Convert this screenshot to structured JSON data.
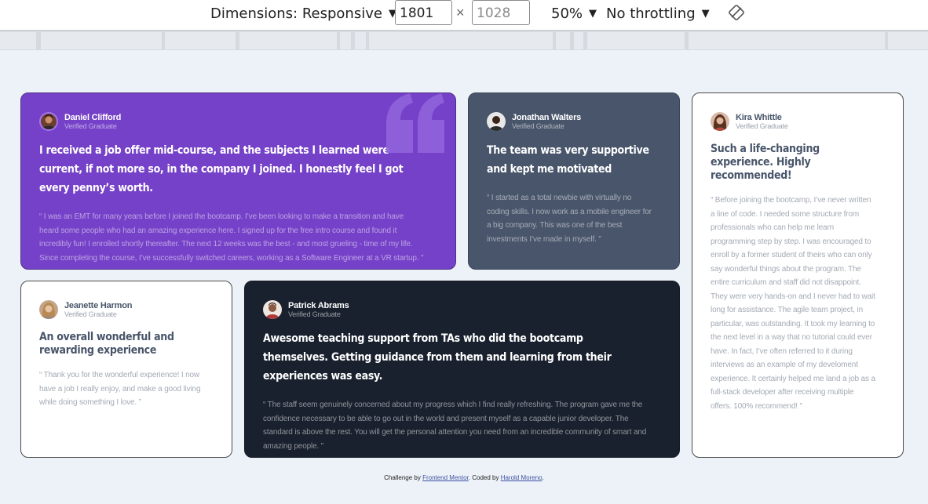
{
  "devtools": {
    "dimensions_label": "Dimensions: Responsive",
    "width_value": "1801",
    "height_placeholder": "1028",
    "times": "×",
    "zoom": "50%",
    "throttling": "No throttling",
    "caret": "▼"
  },
  "testimonials": [
    {
      "name": "Daniel Clifford",
      "status": "Verified Graduate",
      "headline": "I received a job offer mid-course, and the subjects I learned were current, if not more so, in the company I joined. I honestly feel I got every penny’s worth.",
      "quote": "“ I was an EMT for many years before I joined the bootcamp. I’ve been looking to make a transition and have heard some people who had an amazing experience here. I signed up for the free intro course and found it incredibly fun! I enrolled shortly thereafter. The next 12 weeks was the best - and most grueling - time of my life. Since completing the course, I’ve successfully switched careers, working as a Software Engineer at a VR startup. ”"
    },
    {
      "name": "Jonathan Walters",
      "status": "Verified Graduate",
      "headline": "The team was very supportive and kept me motivated",
      "quote": "“ I started as a total newbie with virtually no coding skills. I now work as a mobile engineer for a big company. This was one of the best investments I’ve made in myself. ”"
    },
    {
      "name": "Kira Whittle",
      "status": "Verified Graduate",
      "headline": "Such a life-changing experience. Highly recommended!",
      "quote": "“ Before joining the bootcamp, I’ve never written a line of code. I needed some structure from professionals who can help me learn programming step by step. I was encouraged to enroll by a former student of theirs who can only say wonderful things about the program. The entire curriculum and staff did not disappoint. They were very hands-on and I never had to wait long for assistance. The agile team project, in particular, was outstanding. It took my learning to the next level in a way that no tutorial could ever have. In fact, I’ve often referred to it during interviews as an example of my develoment experience. It certainly helped me land a job as a full-stack developer after receiving multiple offers. 100% recommend! ”"
    },
    {
      "name": "Jeanette Harmon",
      "status": "Verified Graduate",
      "headline": "An overall wonderful and rewarding experience",
      "quote": "“ Thank you for the wonderful experience! I now have a job I really enjoy, and make a good living while doing something I love. ”"
    },
    {
      "name": "Patrick Abrams",
      "status": "Verified Graduate",
      "headline": "Awesome teaching support from TAs who did the bootcamp themselves. Getting guidance from them and learning from their experiences was easy.",
      "quote": "“ The staff seem genuinely concerned about my progress which I find really refreshing. The program gave me the confidence necessary to be able to go out in the world and present myself as a capable junior developer. The standard is above the rest. You will get the personal attention you need from an incredible community of smart and amazing people. ”"
    }
  ],
  "footer": {
    "prefix": "Challenge by ",
    "link1": "Frontend Mentor",
    "middle": ". Coded by ",
    "link2": "Harold Moreno",
    "suffix": "."
  },
  "colors": {
    "purple": "#7541c8",
    "slate": "#48556a",
    "dark": "#19212e",
    "background": "#edf2f8"
  }
}
